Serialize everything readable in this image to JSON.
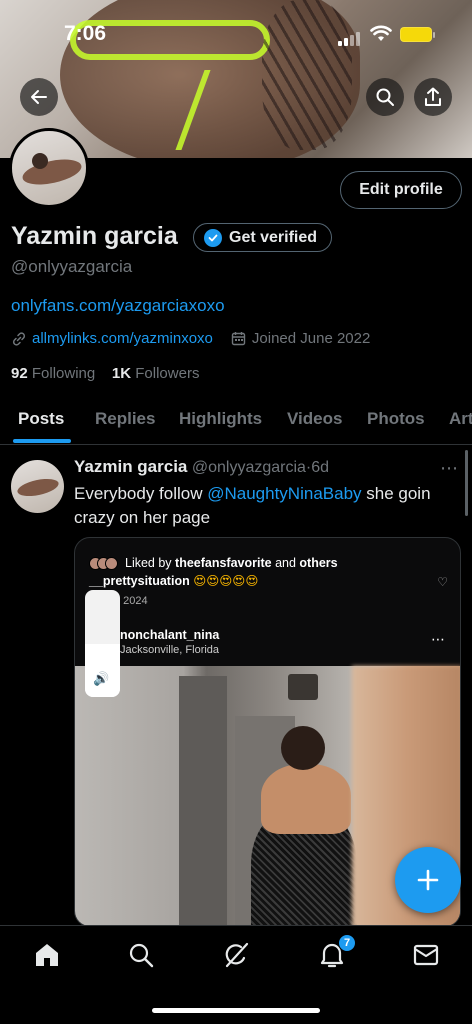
{
  "status_bar": {
    "time": "7:06"
  },
  "profile": {
    "name": "Yazmin garcia",
    "verify_label": "Get verified",
    "handle": "@onlyyazgarcia",
    "bio_link": "onlyfans.com/yazgarciaxoxo",
    "website": "allmylinks.com/yazminxoxo",
    "joined": "Joined June 2022",
    "following_count": "92",
    "following_label": "Following",
    "followers_count": "1K",
    "followers_label": "Followers",
    "edit_label": "Edit profile"
  },
  "tabs": [
    {
      "label": "Posts",
      "active": true
    },
    {
      "label": "Replies"
    },
    {
      "label": "Highlights"
    },
    {
      "label": "Videos"
    },
    {
      "label": "Photos"
    },
    {
      "label": "Art"
    }
  ],
  "post": {
    "author": "Yazmin garcia",
    "handle": "@onlyyazgarcia",
    "separator": "·",
    "age": "6d",
    "text_before": "Everybody follow ",
    "mention": "@NaughtyNinaBaby",
    "text_after": "  she goin crazy on her page",
    "media": {
      "liked_prefix": "Liked by ",
      "liked_user": "theefansfavorite",
      "liked_mid": " and ",
      "liked_suffix": "others",
      "caption_user": "__prettysituation",
      "caption_emoji": "😍😍😍😍😍",
      "date": ", 2024",
      "username": "nonchalant_nina",
      "location": "Jacksonville, Florida"
    }
  },
  "nav": {
    "notifications_badge": "7"
  },
  "colors": {
    "accent": "#1d9bf0",
    "background": "#000000",
    "muted": "#71767b",
    "text": "#e7e9ea"
  }
}
